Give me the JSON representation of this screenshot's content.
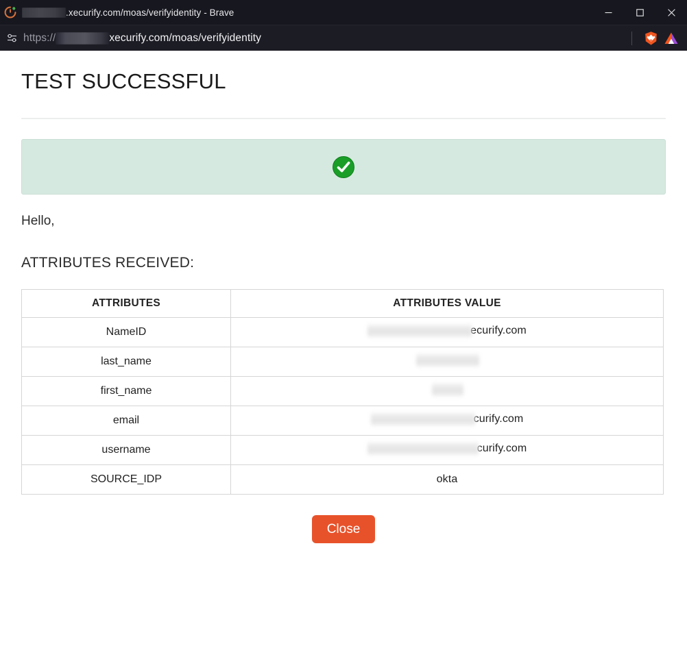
{
  "browser": {
    "name": "Brave",
    "tab": {
      "favicon_name": "xecurify-favicon",
      "title_suffix": ".xecurify.com/moas/verifyidentity - Brave",
      "title_redacted": true
    },
    "window_controls": {
      "minimize": "minimize-icon",
      "maximize": "maximize-icon",
      "close": "close-icon"
    },
    "address_bar": {
      "left_icon": "sliders-icon",
      "scheme": "https://",
      "host_redacted": true,
      "url_visible": "xecurify.com/moas/verifyidentity",
      "right_icons": [
        "brave-lion-icon",
        "bat-triangle-icon"
      ]
    }
  },
  "page": {
    "title": "TEST SUCCESSFUL",
    "banner": {
      "icon": "green-check-circle-icon",
      "bg_color": "#d6e9e0"
    },
    "greeting": "Hello,",
    "attributes_heading": "ATTRIBUTES RECEIVED:",
    "table": {
      "headers": [
        "ATTRIBUTES",
        "ATTRIBUTES VALUE"
      ],
      "rows": [
        {
          "attribute": "NameID",
          "value_suffix": "ecurify.com",
          "redacted": true,
          "redact_width": "w-long"
        },
        {
          "attribute": "last_name",
          "value_suffix": "",
          "redacted": true,
          "redact_width": "w-med"
        },
        {
          "attribute": "first_name",
          "value_suffix": "",
          "redacted": true,
          "redact_width": "w-short"
        },
        {
          "attribute": "email",
          "value_suffix": "curify.com",
          "redacted": true,
          "redact_width": "w-long"
        },
        {
          "attribute": "username",
          "value_suffix": "curify.com",
          "redacted": true,
          "redact_width": "w-user"
        },
        {
          "attribute": "SOURCE_IDP",
          "value_suffix": "okta",
          "redacted": false,
          "redact_width": ""
        }
      ]
    },
    "close_button": "Close",
    "accent_color": "#e8522a"
  }
}
